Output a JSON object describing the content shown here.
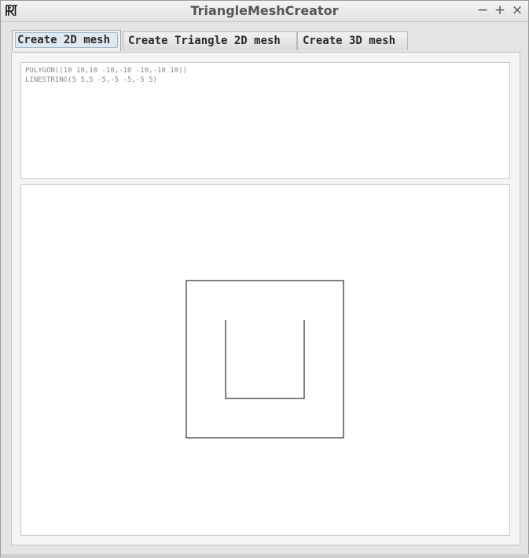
{
  "window": {
    "title": "TriangleMeshCreator",
    "logo_icon": "app-logo-icon",
    "controls": {
      "minimize_label": "−",
      "maximize_label": "+",
      "close_label": "×"
    }
  },
  "tabs": [
    {
      "label": "Create 2D mesh",
      "active": true
    },
    {
      "label": "Create Triangle 2D mesh",
      "active": false
    },
    {
      "label": "Create 3D mesh",
      "active": false
    }
  ],
  "wkt_input": {
    "lines": [
      "POLYGON((10 10,10 -10,-10 -10,-10 10))",
      "LINESTRING(5 5,5 -5,-5 -5,-5 5)"
    ]
  },
  "preview": {
    "stroke_color": "#000000",
    "background": "#ffffff",
    "polygon": [
      [
        10,
        10
      ],
      [
        10,
        -10
      ],
      [
        -10,
        -10
      ],
      [
        -10,
        10
      ]
    ],
    "linestring": [
      [
        5,
        5
      ],
      [
        5,
        -5
      ],
      [
        -5,
        -5
      ],
      [
        -5,
        5
      ]
    ]
  }
}
